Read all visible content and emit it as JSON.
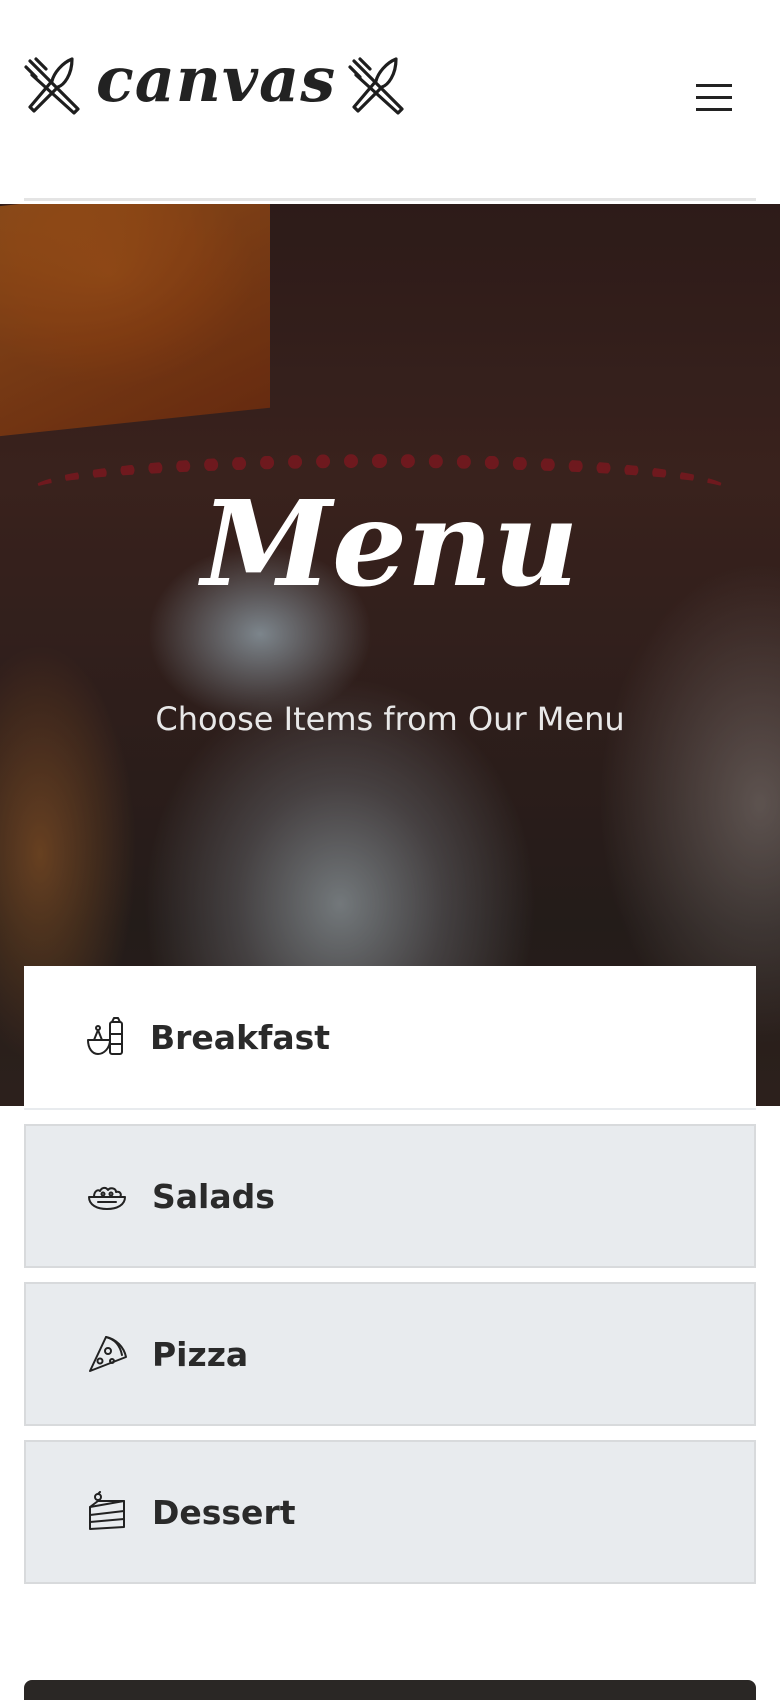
{
  "header": {
    "logo_text": "canvas",
    "menu_icon": "hamburger-menu-icon"
  },
  "hero": {
    "title": "Menu",
    "subtitle": "Choose Items from Our Menu",
    "background_image": "chef-kitchen-photo"
  },
  "categories": [
    {
      "label": "Breakfast",
      "icon": "breakfast-icon",
      "active": true
    },
    {
      "label": "Salads",
      "icon": "salad-bowl-icon",
      "active": false
    },
    {
      "label": "Pizza",
      "icon": "pizza-slice-icon",
      "active": false
    },
    {
      "label": "Dessert",
      "icon": "cake-slice-icon",
      "active": false
    }
  ],
  "colors": {
    "text_dark": "#222222",
    "category_bg": "#e8ebee",
    "category_active_bg": "#ffffff"
  }
}
